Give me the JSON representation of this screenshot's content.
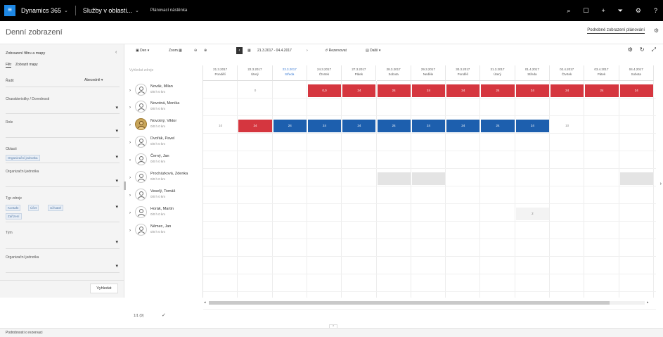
{
  "topbar": {
    "brand": "Dynamics 365",
    "area": "Služby v oblasti...",
    "crumb": "Plánovací nástěnka"
  },
  "page": {
    "title": "Denní zobrazení",
    "header_link": "Podrobné zobrazení plánování"
  },
  "filter": {
    "title": "Zobrazení filtru a mapy",
    "tabs": [
      "Filtr",
      "Zobrazit mapy"
    ],
    "sort_label": "Řadit",
    "sort_value": "Abecedně",
    "fields": [
      {
        "label": "Charakteristiky / Dovednosti",
        "chips": []
      },
      {
        "label": "Role",
        "chips": []
      },
      {
        "label": "Oblasti",
        "chips": [
          "Organizační jednotka"
        ]
      },
      {
        "label": "Organizační jednotka",
        "chips": []
      },
      {
        "label": "Typ zdroje",
        "chips": [
          "Kontakt",
          "Účet",
          "Uživatel",
          "Zařízení"
        ]
      },
      {
        "label": "Tým",
        "chips": []
      },
      {
        "label": "Organizační jednotka",
        "chips": []
      }
    ],
    "search_button": "Vyhledat"
  },
  "toolbar": {
    "day": "Den",
    "zoom": "Zoom",
    "date_range": "21.3.2017 - 04.4.2017",
    "reserve": "Rezervovat",
    "more": "Další"
  },
  "resources": {
    "search_placeholder": "Vyhledat zdroje",
    "rows": [
      {
        "name": "Novák, Milan",
        "sub": "0/0 h  0 km",
        "photo": false
      },
      {
        "name": "Novotná, Monika",
        "sub": "0/0 h  0 km",
        "photo": false
      },
      {
        "name": "Novotný, Viktor",
        "sub": "0/0 h  0 km",
        "photo": true
      },
      {
        "name": "Dvořák, Pavel",
        "sub": "0/0 h  0 km",
        "photo": false
      },
      {
        "name": "Černý, Jan",
        "sub": "0/0 h  0 km",
        "photo": false
      },
      {
        "name": "Procházková, Zdenka",
        "sub": "0/0 h  0 km",
        "photo": false
      },
      {
        "name": "Veselý, Tomáš",
        "sub": "0/0 h  0 km",
        "photo": false
      },
      {
        "name": "Horák, Martin",
        "sub": "0/0 h  0 km",
        "photo": false
      },
      {
        "name": "Němec, Jan",
        "sub": "0/0 h  0 km",
        "photo": false
      }
    ]
  },
  "grid": {
    "columns": [
      {
        "date": "21.3.2017",
        "weekday": "Pondělí"
      },
      {
        "date": "22.3.2017",
        "weekday": "Úterý"
      },
      {
        "date": "23.3.2017",
        "weekday": "Středa"
      },
      {
        "date": "24.3.2017",
        "weekday": "Čtvrtek"
      },
      {
        "date": "27.3.2017",
        "weekday": "Pátek"
      },
      {
        "date": "28.3.2017",
        "weekday": "Sobota"
      },
      {
        "date": "29.3.2017",
        "weekday": "Neděle"
      },
      {
        "date": "30.3.2017",
        "weekday": "Pondělí"
      },
      {
        "date": "31.3.2017",
        "weekday": "Úterý"
      },
      {
        "date": "01.4.2017",
        "weekday": "Středa"
      },
      {
        "date": "02.4.2017",
        "weekday": "Čtvrtek"
      },
      {
        "date": "03.4.2017",
        "weekday": "Pátek"
      },
      {
        "date": "04.4.2017",
        "weekday": "Sobota"
      }
    ],
    "today_index": 2,
    "rows": [
      {
        "row": 0,
        "cells": [
          {
            "col": 1,
            "style": "plain",
            "text": "0"
          },
          {
            "col": 3,
            "style": "red",
            "text": "0,0"
          },
          {
            "col": 4,
            "style": "red",
            "text": "24"
          },
          {
            "col": 5,
            "style": "red",
            "text": "24"
          },
          {
            "col": 6,
            "style": "red",
            "text": "24"
          },
          {
            "col": 7,
            "style": "red",
            "text": "24"
          },
          {
            "col": 8,
            "style": "red",
            "text": "24"
          },
          {
            "col": 9,
            "style": "red",
            "text": "24"
          },
          {
            "col": 10,
            "style": "red",
            "text": "24"
          },
          {
            "col": 11,
            "style": "red",
            "text": "24"
          },
          {
            "col": 12,
            "style": "red",
            "text": "24"
          }
        ]
      },
      {
        "row": 2,
        "cells": [
          {
            "col": 0,
            "style": "plain",
            "text": "10"
          },
          {
            "col": 1,
            "style": "red",
            "text": "24"
          },
          {
            "col": 2,
            "style": "blue",
            "text": "24"
          },
          {
            "col": 3,
            "style": "blue",
            "text": "24"
          },
          {
            "col": 4,
            "style": "blue",
            "text": "24"
          },
          {
            "col": 5,
            "style": "blue",
            "text": "24"
          },
          {
            "col": 6,
            "style": "blue",
            "text": "24"
          },
          {
            "col": 7,
            "style": "blue",
            "text": "24"
          },
          {
            "col": 8,
            "style": "blue",
            "text": "24"
          },
          {
            "col": 9,
            "style": "blue",
            "text": "24"
          },
          {
            "col": 10,
            "style": "plain",
            "text": "10"
          }
        ]
      },
      {
        "row": 5,
        "cells": [
          {
            "col": 5,
            "style": "gray",
            "text": ""
          },
          {
            "col": 6,
            "style": "gray",
            "text": ""
          },
          {
            "col": 12,
            "style": "gray",
            "text": ""
          }
        ]
      },
      {
        "row": 7,
        "cells": [
          {
            "col": 9,
            "style": "light",
            "text": "2"
          }
        ]
      }
    ]
  },
  "pager": {
    "label": "1/1 (9)"
  },
  "statusbar": {
    "text": "Podrobnosti o rezervaci"
  }
}
